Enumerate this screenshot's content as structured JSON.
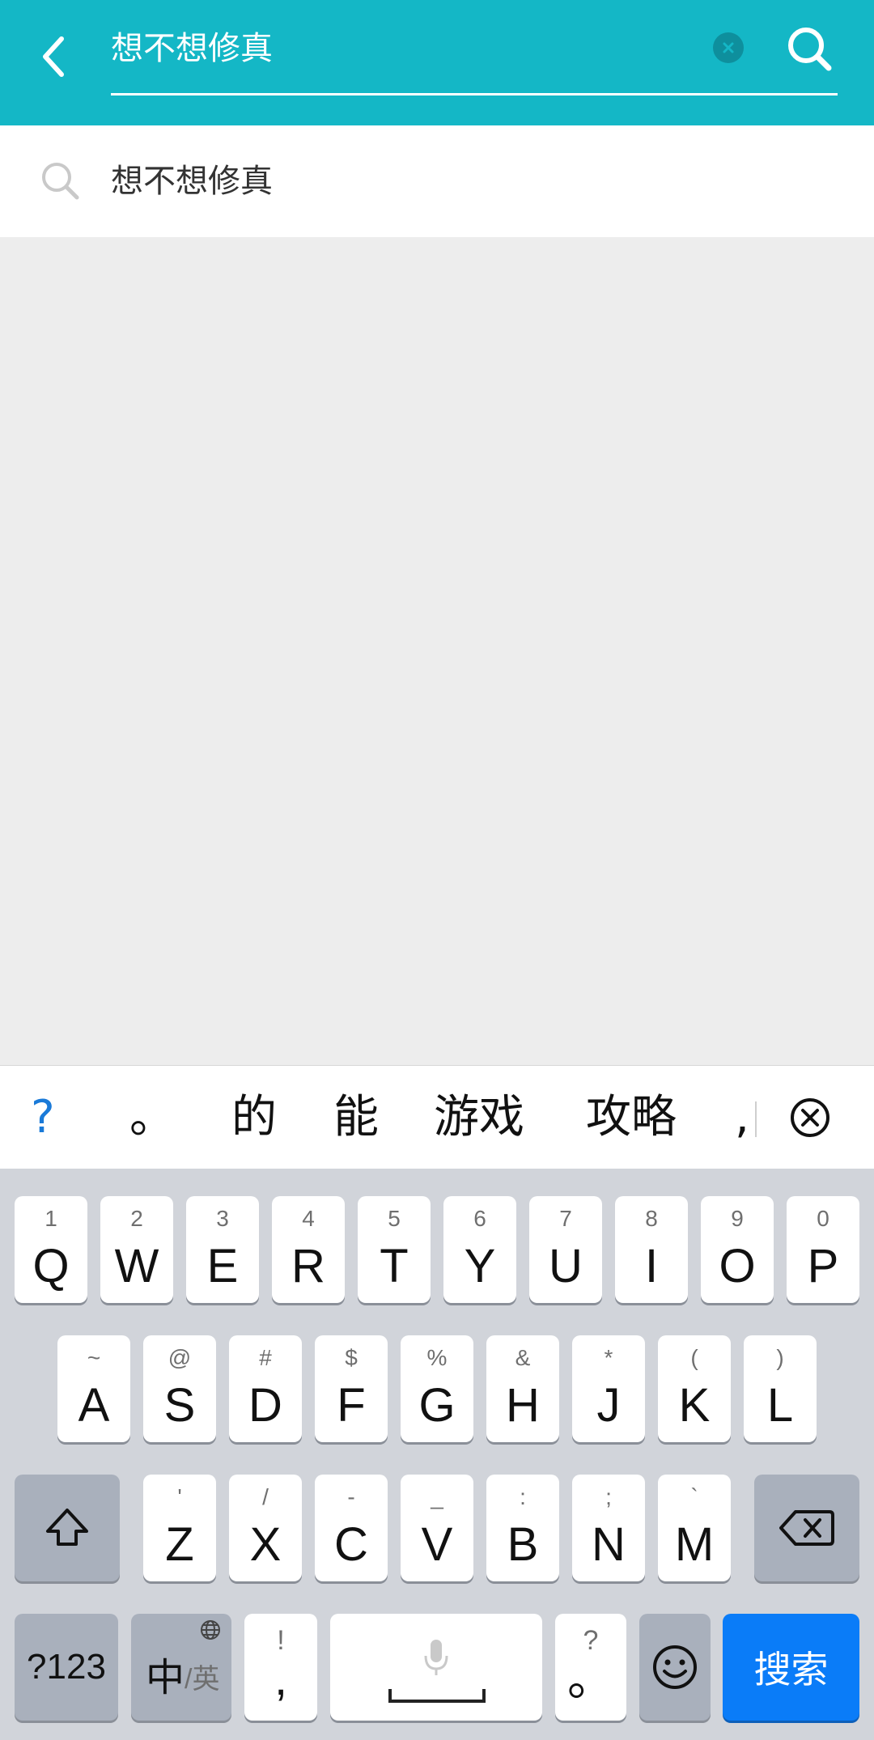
{
  "header": {
    "query": "想不想修真",
    "back_icon": "chevron-left-icon",
    "clear_icon": "clear-icon",
    "search_icon": "search-icon"
  },
  "suggestions": [
    {
      "text": "想不想修真"
    }
  ],
  "candidates": [
    "?",
    "。",
    "的",
    "能",
    "游戏",
    "攻略",
    ","
  ],
  "keyboard": {
    "row1": [
      {
        "main": "Q",
        "sub": "1"
      },
      {
        "main": "W",
        "sub": "2"
      },
      {
        "main": "E",
        "sub": "3"
      },
      {
        "main": "R",
        "sub": "4"
      },
      {
        "main": "T",
        "sub": "5"
      },
      {
        "main": "Y",
        "sub": "6"
      },
      {
        "main": "U",
        "sub": "7"
      },
      {
        "main": "I",
        "sub": "8"
      },
      {
        "main": "O",
        "sub": "9"
      },
      {
        "main": "P",
        "sub": "0"
      }
    ],
    "row2": [
      {
        "main": "A",
        "sub": "~"
      },
      {
        "main": "S",
        "sub": "@"
      },
      {
        "main": "D",
        "sub": "#"
      },
      {
        "main": "F",
        "sub": "$"
      },
      {
        "main": "G",
        "sub": "%"
      },
      {
        "main": "H",
        "sub": "&"
      },
      {
        "main": "J",
        "sub": "*"
      },
      {
        "main": "K",
        "sub": "("
      },
      {
        "main": "L",
        "sub": ")"
      }
    ],
    "row3": [
      {
        "main": "Z",
        "sub": "'"
      },
      {
        "main": "X",
        "sub": "/"
      },
      {
        "main": "C",
        "sub": "-"
      },
      {
        "main": "V",
        "sub": "_"
      },
      {
        "main": "B",
        "sub": ":"
      },
      {
        "main": "N",
        "sub": ";"
      },
      {
        "main": "M",
        "sub": "`"
      }
    ],
    "bottom": {
      "num_label": "?123",
      "lang_main": "中",
      "lang_sub": "/英",
      "punct_top": "!",
      "punct_main": ",",
      "punct2_top": "?",
      "punct2_main": "。",
      "action_label": "搜索"
    }
  },
  "colors": {
    "header_bg": "#14b7c6",
    "action_key": "#0a7cf8"
  }
}
